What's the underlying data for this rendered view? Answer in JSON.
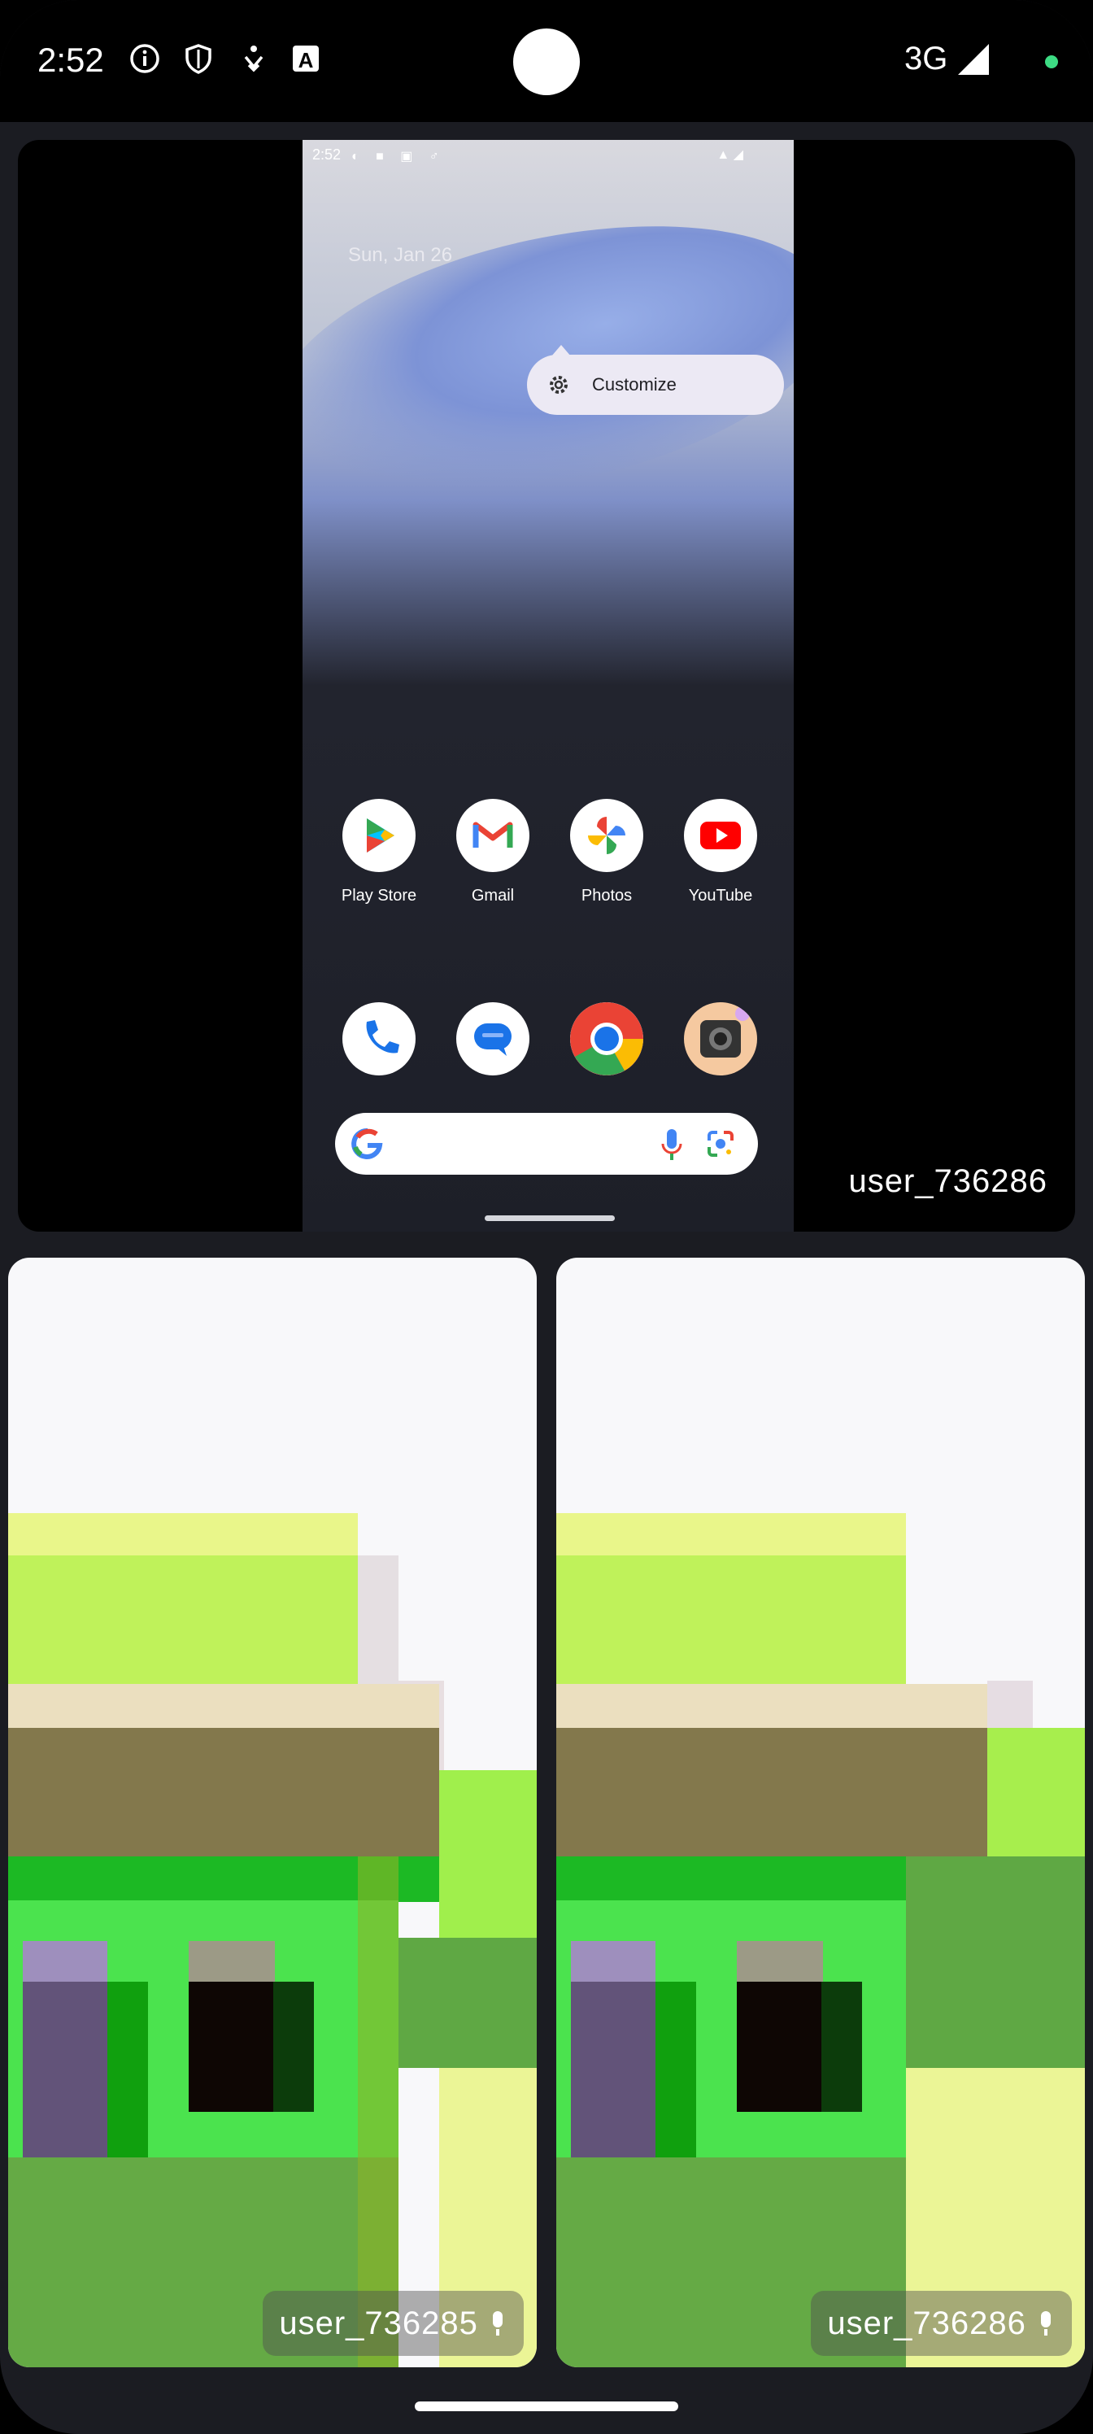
{
  "status_bar": {
    "time": "2:52",
    "network": "3G",
    "icons": [
      "info-icon",
      "shield-icon",
      "accessibility-icon",
      "a-box-icon",
      "signal-icon"
    ],
    "indicator_color": "#3ddc84"
  },
  "main_tile": {
    "username": "user_736286",
    "mirror": {
      "time": "2:52",
      "date": "Sun, Jan 26",
      "popup_label": "Customize",
      "apps": [
        {
          "label": "Play Store",
          "icon": "play-store-icon"
        },
        {
          "label": "Gmail",
          "icon": "gmail-icon"
        },
        {
          "label": "Photos",
          "icon": "photos-icon"
        },
        {
          "label": "YouTube",
          "icon": "youtube-icon"
        }
      ],
      "dock": [
        "phone-icon",
        "messages-icon",
        "chrome-icon",
        "camera-app-icon"
      ],
      "search_icons": [
        "google-g-icon",
        "microphone-icon",
        "lens-icon"
      ]
    }
  },
  "participants": [
    {
      "username": "user_736285",
      "mic_icon": "microphone-icon"
    },
    {
      "username": "user_736286",
      "mic_icon": "microphone-icon"
    }
  ]
}
